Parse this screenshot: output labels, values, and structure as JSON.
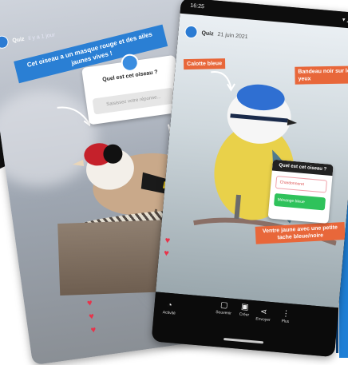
{
  "left_story": {
    "account_name": "Quiz",
    "time": "il y a 1 jour",
    "banner_text": "Cet oiseau a un masque rouge et des ailes jaunes vives !",
    "quiz": {
      "question": "Quel est cet oiseau ?",
      "input_placeholder": "Saisissez votre réponse..."
    },
    "hearts": [
      "♥",
      "♥",
      "♥"
    ]
  },
  "right_story": {
    "status": {
      "time": "16:25",
      "right_icons": "▾ ◢ ▮"
    },
    "account_name": "Quiz",
    "time": "21 juin 2021",
    "tags": {
      "calotte": "Calotte bleue",
      "bandeau": "Bandeau noir sur les yeux",
      "ventre": "Ventre jaune avec une petite tache bleue/noire"
    },
    "answer_card": {
      "title": "Quel est cet oiseau ?",
      "wrong": "Chardonneret",
      "right": "Mésange bleue"
    },
    "hearts": [
      "♥",
      "♥"
    ],
    "toolbar": [
      {
        "icon": "◔",
        "label": "Activité"
      },
      {
        "icon": "▢",
        "label": "Souvenir"
      },
      {
        "icon": "▣",
        "label": "Créer"
      },
      {
        "icon": "⋖",
        "label": "Envoyer"
      },
      {
        "icon": "⋮",
        "label": "Plus"
      }
    ]
  },
  "colors": {
    "accent_blue": "#2a7fd4",
    "tag_orange": "#e8673a",
    "correct_green": "#2fc25b",
    "heart_red": "#e8334a"
  }
}
